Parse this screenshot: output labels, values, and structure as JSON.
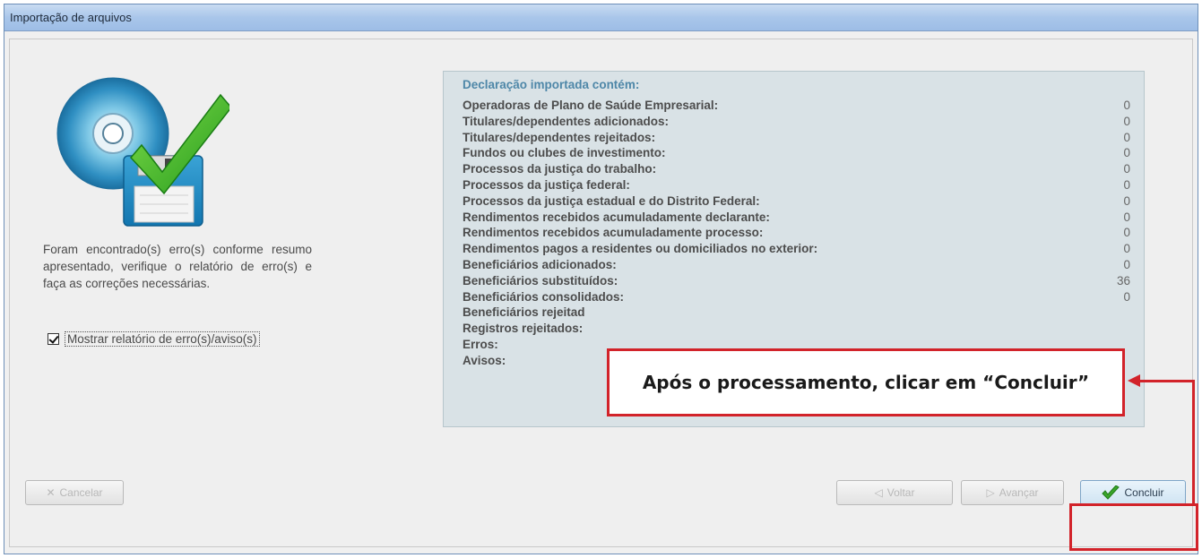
{
  "window": {
    "title": "Importação de arquivos"
  },
  "message": {
    "text": "Foram encontrado(s) erro(s) conforme resumo apresentado, verifique o relatório de erro(s) e faça as correções necessárias."
  },
  "checkbox": {
    "label": "Mostrar relatório de erro(s)/aviso(s)",
    "checked": true
  },
  "summary": {
    "heading": "Declaração importada contém:",
    "rows": [
      {
        "label": "Operadoras de Plano de Saúde Empresarial:",
        "value": "0"
      },
      {
        "label": "Titulares/dependentes adicionados:",
        "value": "0"
      },
      {
        "label": "Titulares/dependentes rejeitados:",
        "value": "0"
      },
      {
        "label": "Fundos ou clubes de investimento:",
        "value": "0"
      },
      {
        "label": "Processos da justiça do trabalho:",
        "value": "0"
      },
      {
        "label": "Processos da justiça federal:",
        "value": "0"
      },
      {
        "label": "Processos da justiça estadual e do Distrito Federal:",
        "value": "0"
      },
      {
        "label": "Rendimentos recebidos acumuladamente declarante:",
        "value": "0"
      },
      {
        "label": "Rendimentos recebidos acumuladamente processo:",
        "value": "0"
      },
      {
        "label": "Rendimentos pagos a residentes ou domiciliados no exterior:",
        "value": "0"
      },
      {
        "label": "Beneficiários adicionados:",
        "value": "0"
      },
      {
        "label": "Beneficiários substituídos:",
        "value": "36"
      },
      {
        "label": "Beneficiários consolidados:",
        "value": "0"
      },
      {
        "label": "Beneficiários rejeitad",
        "value": ""
      },
      {
        "label": "Registros rejeitados:",
        "value": ""
      },
      {
        "label": "Erros:",
        "value": ""
      },
      {
        "label": "Avisos:",
        "value": ""
      }
    ]
  },
  "buttons": {
    "cancel": "Cancelar",
    "back": "Voltar",
    "next": "Avançar",
    "finish": "Concluir"
  },
  "annotation": {
    "text": "Após o processamento, clicar em “Concluir”",
    "color": "#d2232a"
  }
}
